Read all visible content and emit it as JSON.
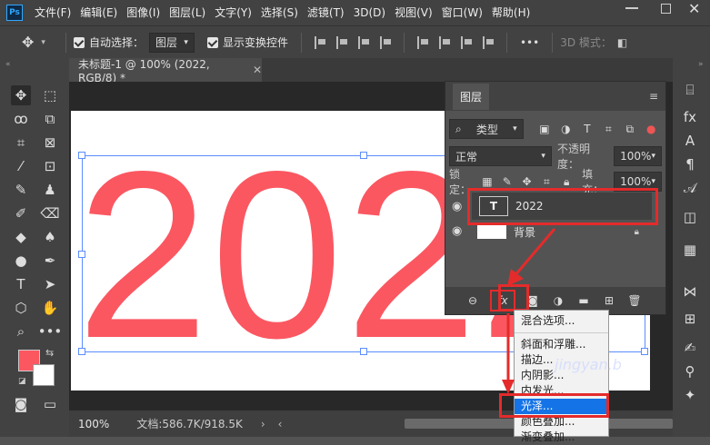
{
  "app": {
    "logo": "Ps"
  },
  "menu": [
    "文件(F)",
    "编辑(E)",
    "图像(I)",
    "图层(L)",
    "文字(Y)",
    "选择(S)",
    "滤镜(T)",
    "3D(D)",
    "视图(V)",
    "窗口(W)",
    "帮助(H)"
  ],
  "options": {
    "auto_select_label": "自动选择：",
    "auto_select_value": "图层",
    "show_transform_label": "显示变换控件",
    "more": "•••",
    "mode_3d": "3D 模式："
  },
  "document": {
    "tab_title": "未标题-1 @ 100% (2022, RGB/8) *",
    "text": "2022",
    "canvas_color": "#ffffff",
    "text_color": "#fb5761"
  },
  "status": {
    "zoom": "100%",
    "doc_info": "文档:586.7K/918.5K"
  },
  "layers_panel": {
    "title": "图层",
    "filter_label": "类型",
    "blend_mode": "正常",
    "opacity_label": "不透明度：",
    "opacity_value": "100%",
    "lock_label": "锁定：",
    "fill_label": "填充：",
    "fill_value": "100%",
    "layers": [
      {
        "name": "2022",
        "type": "text"
      },
      {
        "name": "背景",
        "type": "background"
      }
    ]
  },
  "fx_menu": {
    "items": [
      "混合选项...",
      "斜面和浮雕...",
      "描边...",
      "内阴影...",
      "内发光...",
      "光泽...",
      "颜色叠加...",
      "渐变叠加..."
    ],
    "selected": "光泽..."
  },
  "colors": {
    "foreground": "#fb5761",
    "background": "#ffffff",
    "selection": "#1473e6",
    "highlight": "#e42b2b"
  },
  "watermark": "jingyan.b"
}
